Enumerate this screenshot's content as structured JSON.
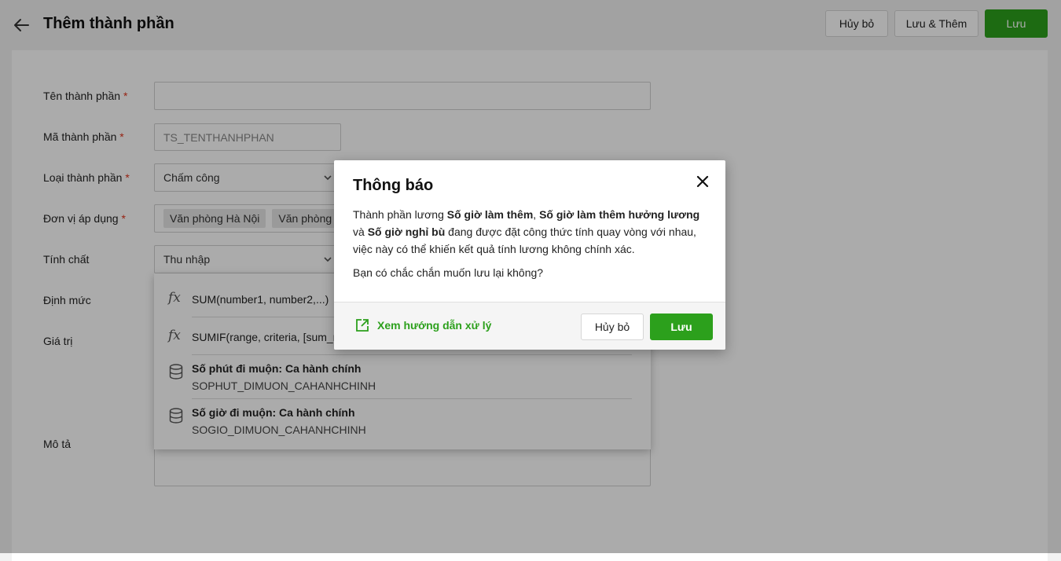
{
  "header": {
    "title": "Thêm thành phần",
    "cancel_label": "Hủy bỏ",
    "save_add_label": "Lưu & Thêm",
    "save_label": "Lưu"
  },
  "form": {
    "name_label": "Tên thành phần",
    "name_value": "",
    "code_label": "Mã thành phần",
    "code_value": "TS_TENTHANHPHAN",
    "type_label": "Loại thành phần",
    "type_value": "Chấm công",
    "unit_label": "Đơn vị áp dụng",
    "unit_tags": [
      "Văn phòng Hà Nội",
      "Văn phòng C"
    ],
    "nature_label": "Tính chất",
    "nature_value": "Thu nhập",
    "norm_label": "Định mức",
    "value_label": "Giá trị",
    "desc_label": "Mô tả",
    "required_mark": "*"
  },
  "dropdown": {
    "items": [
      {
        "kind": "function",
        "icon": "fx-icon",
        "text": "SUM(number1, number2,...)"
      },
      {
        "kind": "function",
        "icon": "fx-icon",
        "text": "SUMIF(range, criteria, [sum_ra"
      },
      {
        "kind": "field",
        "icon": "database-icon",
        "title": "Số phút đi muộn: Ca hành chính",
        "code": "SOPHUT_DIMUON_CAHANHCHINH"
      },
      {
        "kind": "field",
        "icon": "database-icon",
        "title": "Số giờ đi muộn: Ca hành chính",
        "code": "SOGIO_DIMUON_CAHANHCHINH"
      }
    ],
    "fx_symbol": "fx"
  },
  "modal": {
    "title": "Thông báo",
    "body_1": "Thành phần lương ",
    "body_b1": "Số giờ làm thêm",
    "body_2": ", ",
    "body_b2": "Số giờ làm thêm hưởng lương",
    "body_3": " và ",
    "body_b3": "Số giờ nghỉ bù",
    "body_4": " đang được đặt công thức tính quay vòng với nhau, việc này có thể khiến kết quả tính lương không chính xác.",
    "question": "Bạn có chắc chắn muốn lưu lại không?",
    "guide_link": "Xem hướng dẫn xử lý",
    "cancel_label": "Hủy bỏ",
    "save_label": "Lưu"
  },
  "colors": {
    "accent": "#2ca01c",
    "required": "#e0341c"
  }
}
